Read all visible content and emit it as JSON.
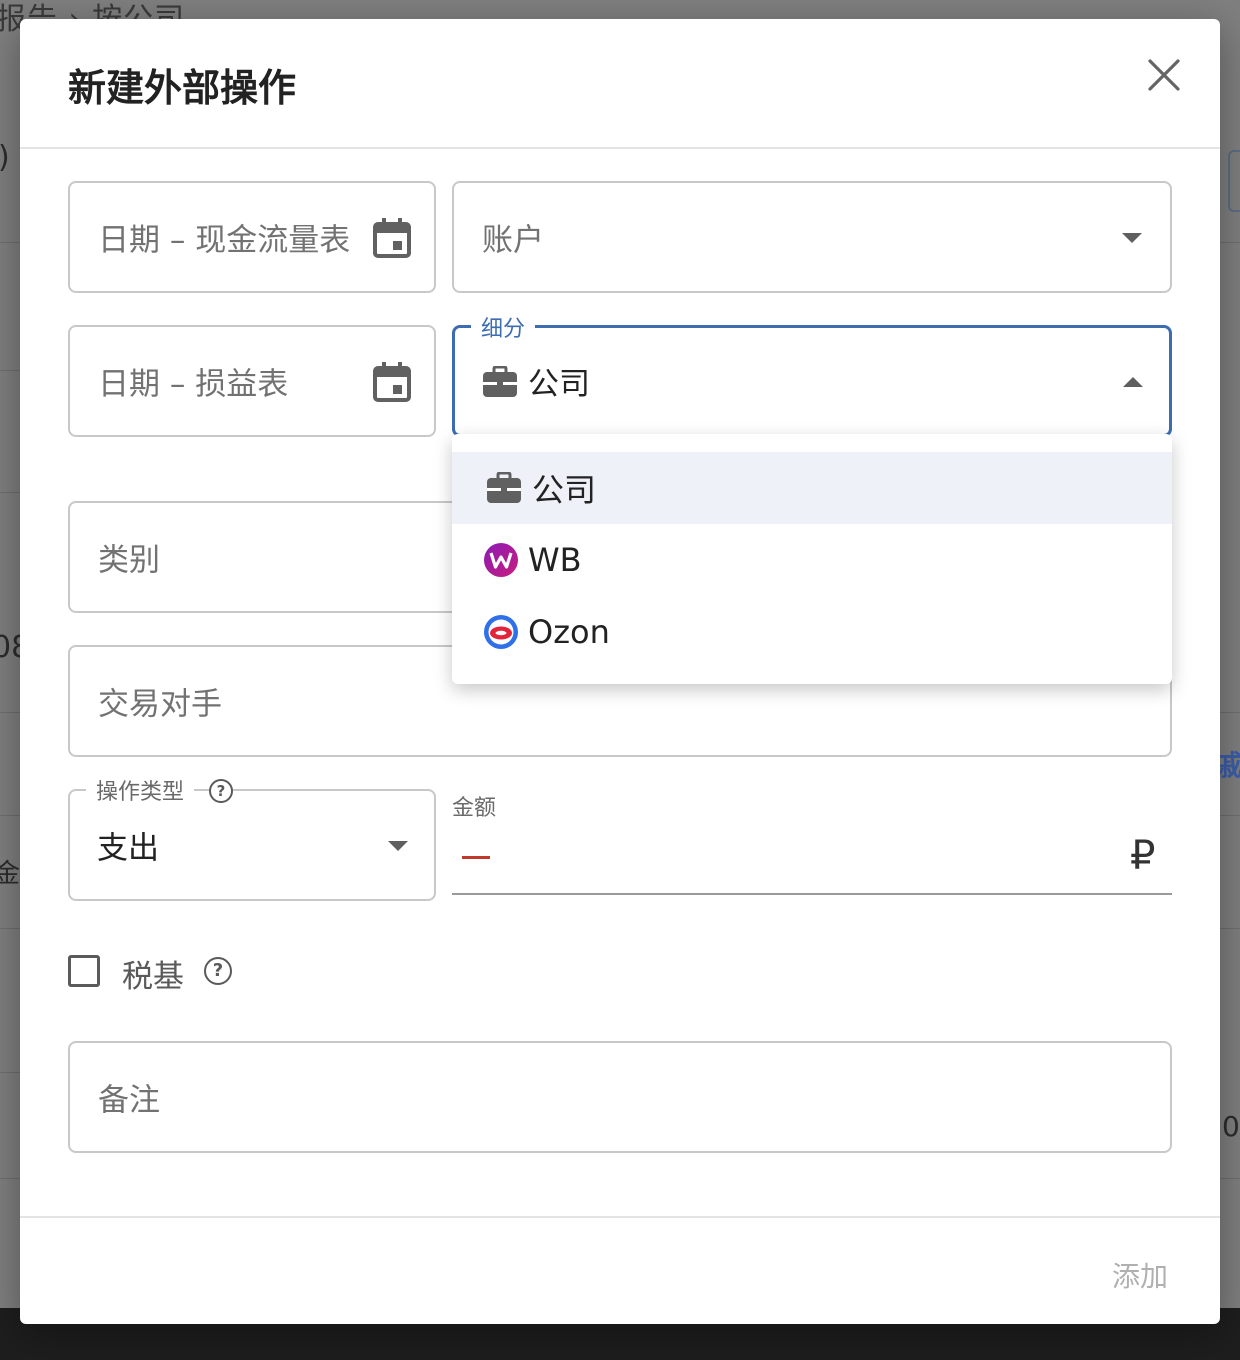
{
  "background": {
    "breadcrumb": "报告  ›  按公司 –",
    "fragments": [
      ")",
      "08",
      "金",
      "戚",
      "0"
    ]
  },
  "modal": {
    "title": "新建外部操作",
    "close_icon": "close-icon",
    "footer": {
      "add_label": "添加"
    }
  },
  "form": {
    "date_cashflow": {
      "placeholder": "日期 – 现金流量表",
      "icon": "calendar-icon"
    },
    "account": {
      "placeholder": "账户"
    },
    "date_pnl": {
      "placeholder": "日期 – 损益表",
      "icon": "calendar-icon"
    },
    "segment": {
      "label": "细分",
      "value": "公司",
      "icon": "briefcase-icon"
    },
    "category": {
      "placeholder": "类别"
    },
    "counterparty": {
      "placeholder": "交易对手"
    },
    "operation_type": {
      "label": "操作类型",
      "value": "支出",
      "help_icon": "help-icon"
    },
    "amount": {
      "label": "金额",
      "sign": "–",
      "currency": "₽"
    },
    "tax_base": {
      "label": "税基",
      "checked": false,
      "help_icon": "help-icon"
    },
    "note": {
      "placeholder": "备注"
    }
  },
  "segment_menu": {
    "items": [
      {
        "label": "公司",
        "icon": "briefcase-icon",
        "selected": true
      },
      {
        "label": "WB",
        "icon": "wb-logo-icon",
        "selected": false
      },
      {
        "label": "Ozon",
        "icon": "ozon-logo-icon",
        "selected": false
      }
    ]
  },
  "colors": {
    "accent": "#3d6db0",
    "minus": "#c0392b",
    "overlay": "#7f7f7f"
  }
}
